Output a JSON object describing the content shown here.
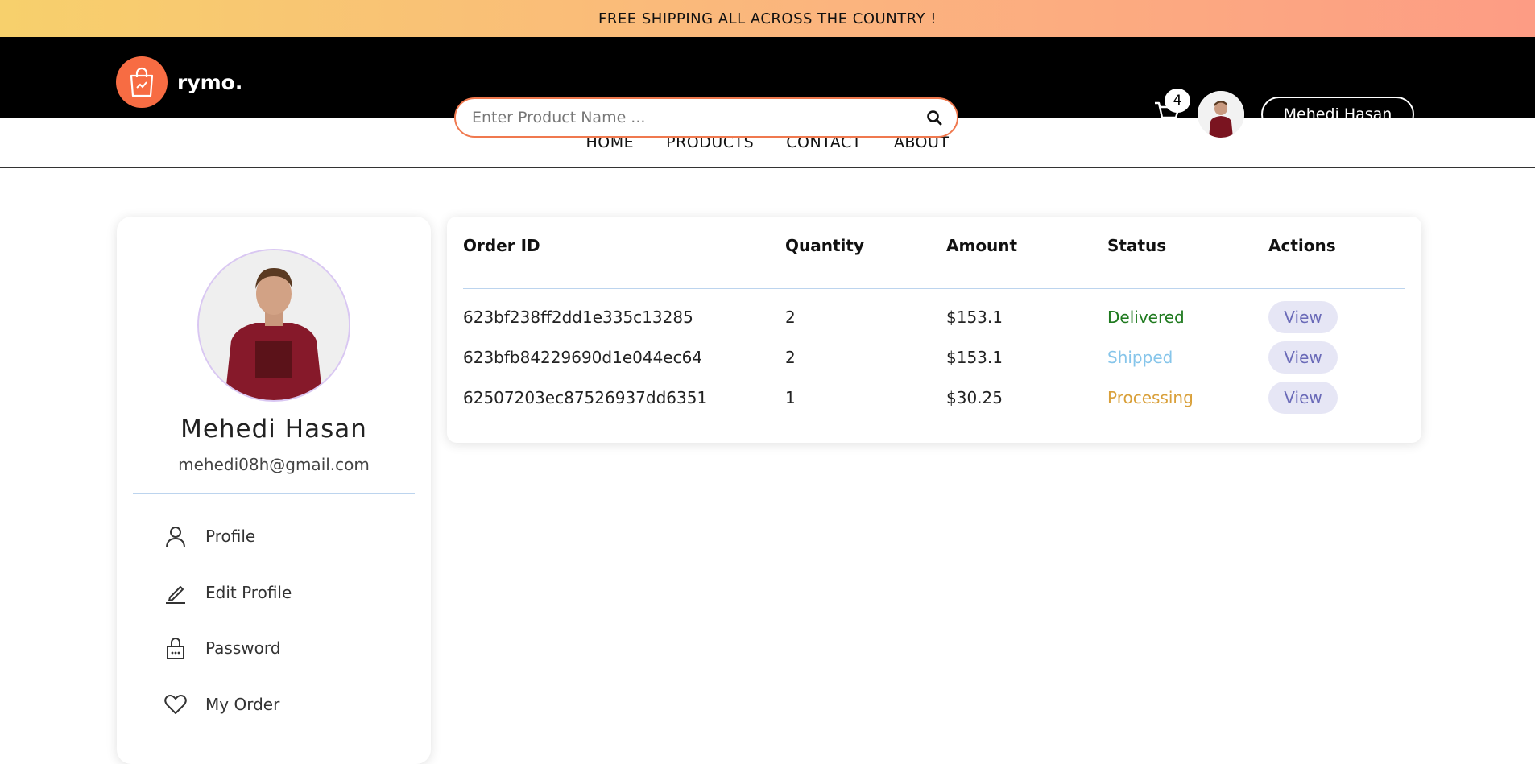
{
  "promo": {
    "text": "FREE SHIPPING ALL ACROSS THE COUNTRY !"
  },
  "header": {
    "brand": "rymo.",
    "search_placeholder": "Enter Product Name ...",
    "cart_count": "4",
    "user_name": "Mehedi Hasan"
  },
  "nav": {
    "items": [
      "HOME",
      "PRODUCTS",
      "CONTACT",
      "ABOUT"
    ]
  },
  "profile": {
    "name": "Mehedi Hasan",
    "email": "mehedi08h@gmail.com",
    "menu": [
      {
        "label": "Profile",
        "icon": "user-icon"
      },
      {
        "label": "Edit Profile",
        "icon": "pencil-icon"
      },
      {
        "label": "Password",
        "icon": "lock-icon"
      },
      {
        "label": "My Order",
        "icon": "heart-icon"
      }
    ]
  },
  "orders": {
    "columns": [
      "Order ID",
      "Quantity",
      "Amount",
      "Status",
      "Actions"
    ],
    "rows": [
      {
        "id": "623bf238ff2dd1e335c13285",
        "qty": "2",
        "amount": "$153.1",
        "status": "Delivered",
        "status_color": "#1f7a1f",
        "action": "View"
      },
      {
        "id": "623bfb84229690d1e044ec64",
        "qty": "2",
        "amount": "$153.1",
        "status": "Shipped",
        "status_color": "#86c5ea",
        "action": "View"
      },
      {
        "id": "62507203ec87526937dd6351",
        "qty": "1",
        "amount": "$30.25",
        "status": "Processing",
        "status_color": "#d9a03a",
        "action": "View"
      }
    ]
  },
  "colors": {
    "accent": "#f76c43",
    "header_bg": "#000000",
    "view_bg": "#e6e6f5",
    "view_text": "#6a6ab8"
  }
}
